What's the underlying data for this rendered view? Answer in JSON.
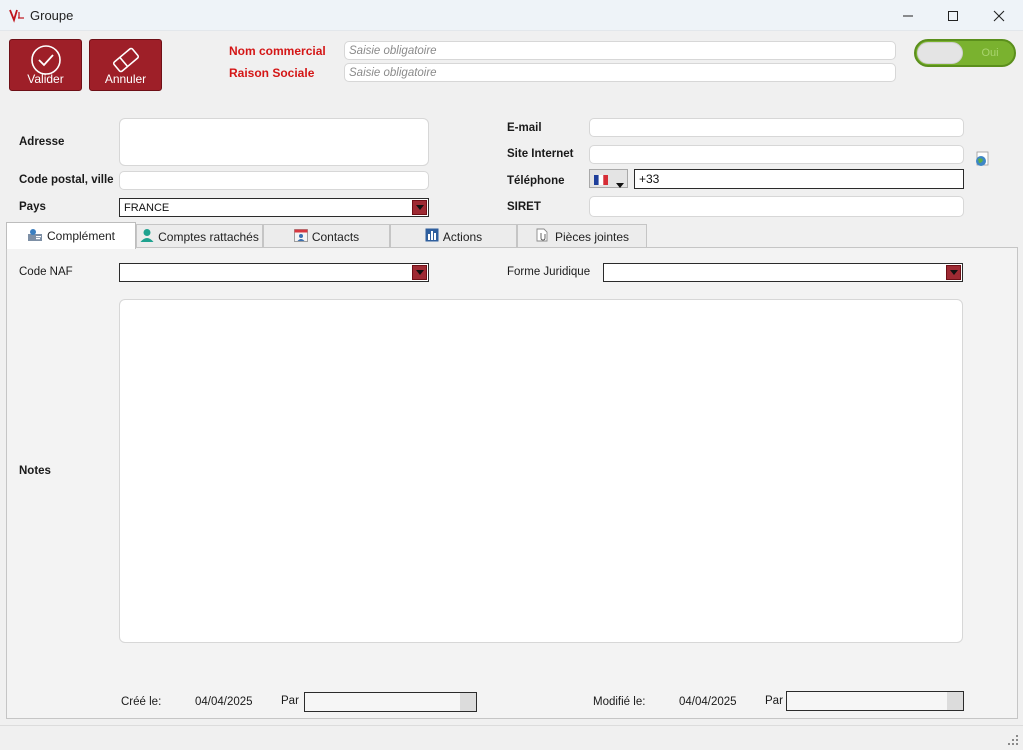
{
  "window": {
    "title": "Groupe",
    "logo_label": "ViL"
  },
  "toolbar": {
    "validate_label": "Valider",
    "cancel_label": "Annuler"
  },
  "identity": {
    "trade_name_label": "Nom commercial",
    "trade_name_placeholder": "Saisie obligatoire",
    "legal_name_label": "Raison Sociale",
    "legal_name_placeholder": "Saisie obligatoire"
  },
  "toggle": {
    "label": "Oui",
    "on": true
  },
  "address": {
    "label": "Adresse",
    "postal_label": "Code postal, ville",
    "country_label": "Pays",
    "country_value": "FRANCE"
  },
  "contact": {
    "email_label": "E-mail",
    "website_label": "Site Internet",
    "phone_label": "Téléphone",
    "phone_value": "+33",
    "siret_label": "SIRET"
  },
  "tabs": [
    {
      "label": "Complément",
      "active": true
    },
    {
      "label": "Comptes rattachés",
      "active": false
    },
    {
      "label": "Contacts",
      "active": false
    },
    {
      "label": "Actions",
      "active": false
    },
    {
      "label": "Pièces jointes",
      "active": false
    }
  ],
  "complement": {
    "naf_label": "Code NAF",
    "legal_form_label": "Forme Juridique",
    "notes_label": "Notes"
  },
  "footer": {
    "created_label": "Créé le:",
    "created_date": "04/04/2025",
    "created_by_label": "Par",
    "modified_label": "Modifié le:",
    "modified_date": "04/04/2025",
    "modified_by_label": "Par"
  },
  "colors": {
    "brand_red": "#9e1f28",
    "required_red": "#d41616",
    "toggle_green": "#7ab22f"
  }
}
